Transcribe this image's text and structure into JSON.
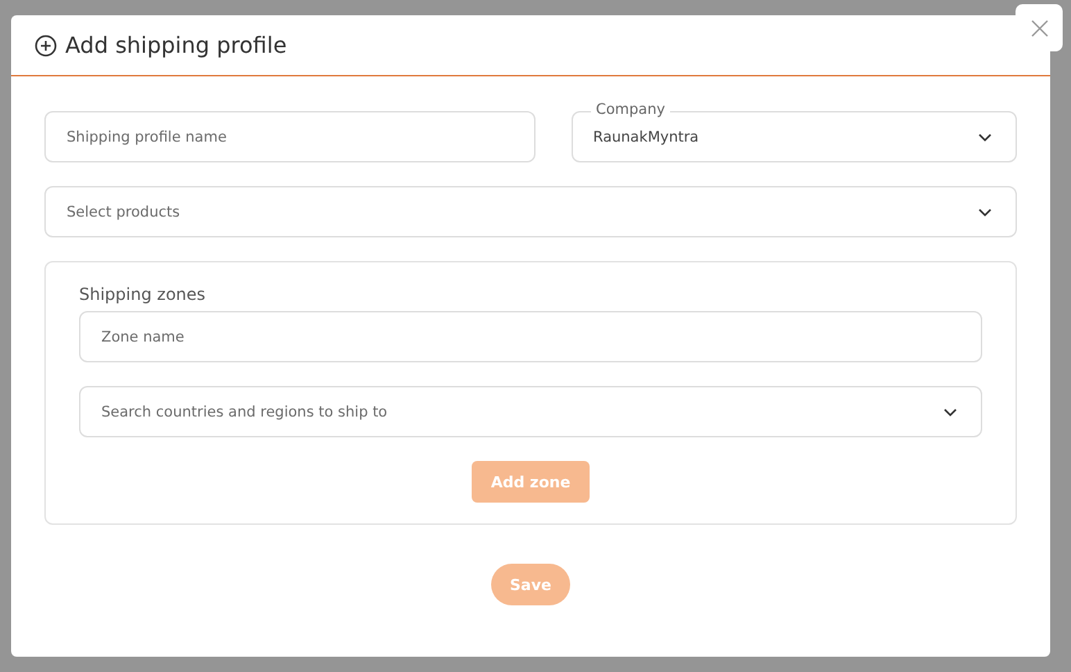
{
  "dialog": {
    "title": "Add shipping profile",
    "rows": [
      {
        "fields": [
          {
            "kind": "text",
            "placeholder": "Shipping profile name"
          },
          {
            "kind": "select",
            "label": "Company",
            "value": "RaunakMyntra"
          }
        ]
      },
      {
        "fields": [
          {
            "kind": "select",
            "placeholder": "Select products"
          }
        ]
      }
    ],
    "zones": {
      "heading": "Shipping zones",
      "fields": [
        {
          "kind": "text",
          "placeholder": "Zone name"
        },
        {
          "kind": "select",
          "placeholder": "Search countries and regions to ship to"
        }
      ],
      "add_button": "Add zone"
    },
    "save_button": "Save"
  }
}
